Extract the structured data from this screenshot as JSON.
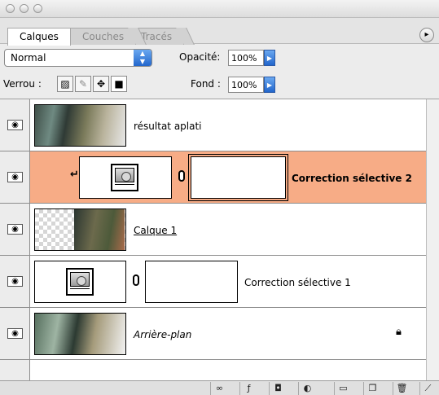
{
  "tabs": [
    {
      "label": "Calques",
      "active": true
    },
    {
      "label": "Couches",
      "active": false
    },
    {
      "label": "Tracés",
      "active": false
    }
  ],
  "options": {
    "blend_mode": "Normal",
    "opacity_label": "Opacité:",
    "opacity_value": "100%",
    "lock_label": "Verrou :",
    "fill_label": "Fond :",
    "fill_value": "100%"
  },
  "layers": [
    {
      "name": "résultat aplati",
      "selected": false,
      "bold": false,
      "italic": false,
      "underline": false,
      "locked": false,
      "kind": "pixel"
    },
    {
      "name": "Correction sélective 2",
      "selected": true,
      "bold": true,
      "italic": false,
      "underline": false,
      "locked": false,
      "kind": "adjustment",
      "clipped": true
    },
    {
      "name": "Calque 1",
      "selected": false,
      "bold": false,
      "italic": false,
      "underline": true,
      "locked": false,
      "kind": "pixel-transparent"
    },
    {
      "name": "Correction sélective 1",
      "selected": false,
      "bold": false,
      "italic": false,
      "underline": false,
      "locked": false,
      "kind": "adjustment"
    },
    {
      "name": "Arrière-plan",
      "selected": false,
      "bold": false,
      "italic": true,
      "underline": false,
      "locked": true,
      "kind": "background"
    }
  ],
  "icons": {
    "eye": "eye-icon",
    "chain": "link-icon",
    "lock": "lock-icon",
    "clip_arrow": "clipping-arrow-icon"
  },
  "colors": {
    "selected_row": "#f7ac86",
    "panel_bg": "#ececec",
    "accent_arrow": "#2266cc"
  }
}
